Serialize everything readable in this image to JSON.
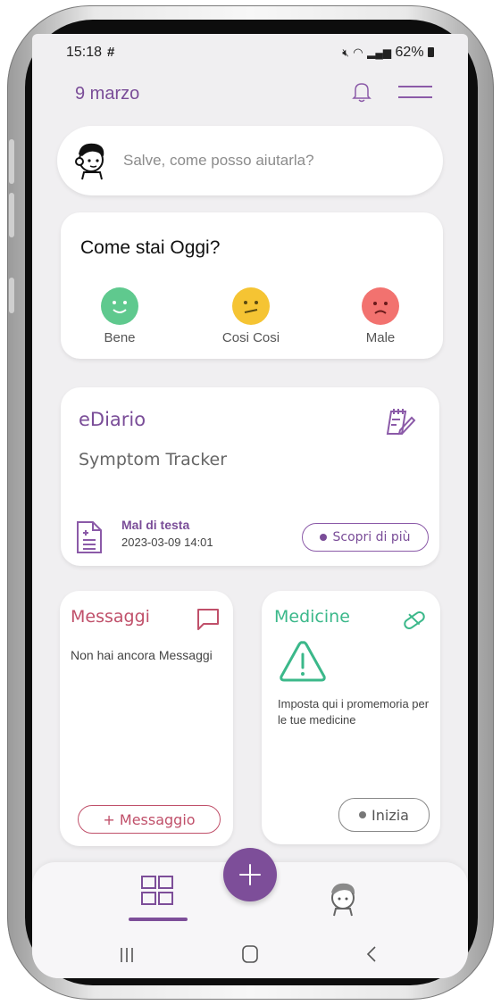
{
  "status_bar": {
    "time": "15:18",
    "battery": "62%"
  },
  "header": {
    "date": "9 marzo"
  },
  "assistant": {
    "placeholder": "Salve, come posso aiutarla?"
  },
  "mood": {
    "title": "Come stai Oggi?",
    "options": [
      {
        "label": "Bene",
        "color": "#5fc98e"
      },
      {
        "label": "Cosi Cosi",
        "color": "#f5c433"
      },
      {
        "label": "Male",
        "color": "#f2726f"
      }
    ]
  },
  "diario": {
    "title": "eDiario",
    "subtitle": "Symptom Tracker",
    "entry_title": "Mal di testa",
    "entry_date": "2023-03-09 14:01",
    "button": "Scopri di più"
  },
  "messages": {
    "title": "Messaggi",
    "empty_text": "Non hai ancora Messaggi",
    "button": "+ Messaggio"
  },
  "medicine": {
    "title": "Medicine",
    "text": "Imposta qui i promemoria per le tue medicine",
    "button": "Inizia"
  },
  "colors": {
    "accent": "#7d4e99",
    "messages": "#c0506a",
    "medicine": "#3bb88a",
    "background": "#f0eff1"
  }
}
